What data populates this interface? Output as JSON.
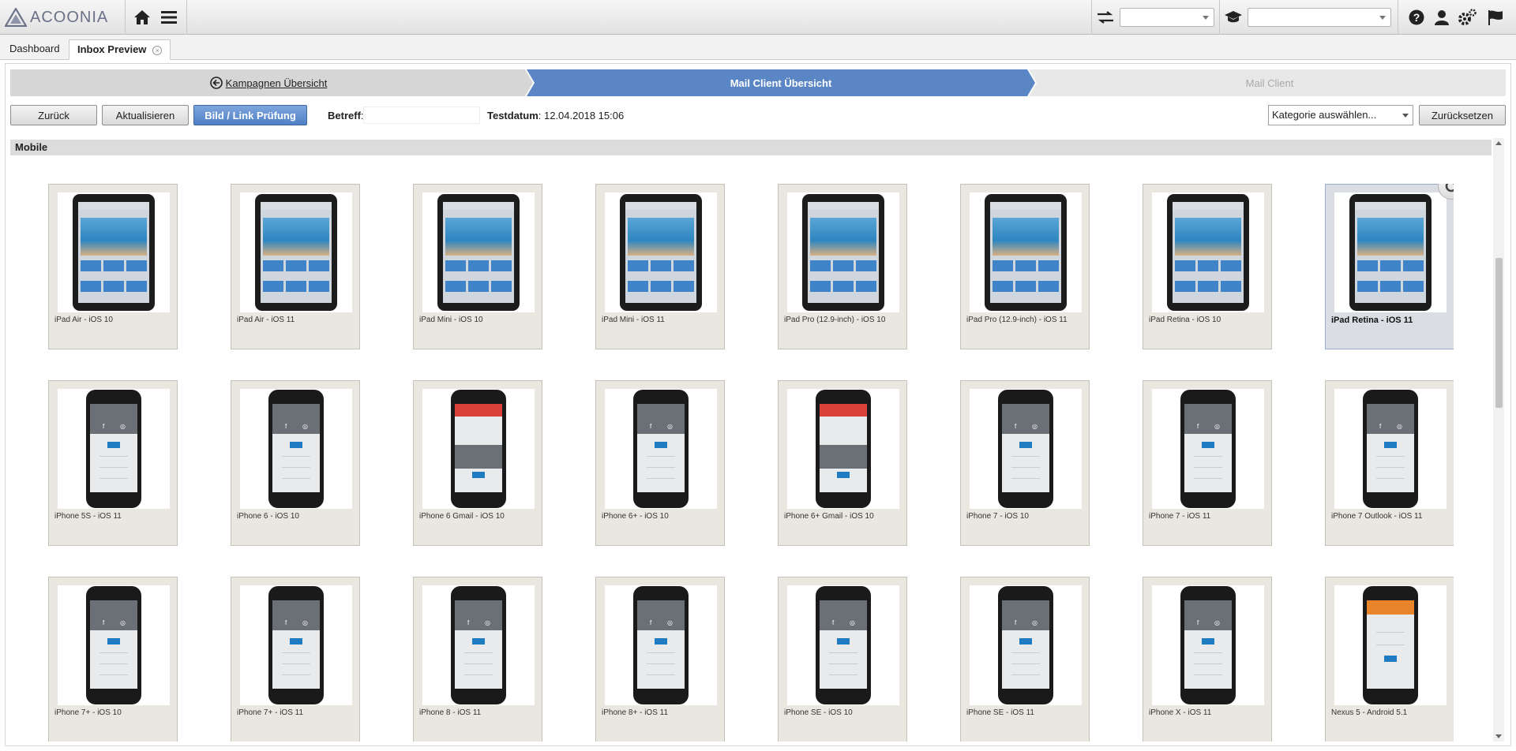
{
  "app": {
    "logo_text": "ACOONIA"
  },
  "tabs": [
    {
      "label": "Dashboard"
    },
    {
      "label": "Inbox Preview"
    }
  ],
  "wizard": {
    "step1": "Kampagnen Übersicht",
    "step2": "Mail Client Übersicht",
    "step3": "Mail Client"
  },
  "toolbar": {
    "back": "Zurück",
    "refresh": "Aktualisieren",
    "check": "Bild / Link Prüfung",
    "betreff_label": "Betreff",
    "betreff_colon": ":",
    "betreff_value": "",
    "testdatum_label": "Testdatum",
    "testdatum_value": ": 12.04.2018 15:06",
    "category_placeholder": "Kategorie auswählen...",
    "reset": "Zurücksetzen"
  },
  "section": {
    "title": "Mobile"
  },
  "colors": {
    "accent": "#5b86c5",
    "card_bg": "#e9e7e0"
  },
  "icons": [
    "home-icon",
    "menu-icon",
    "swap-icon",
    "graduation-cap-icon",
    "help-icon",
    "user-icon",
    "settings-icon",
    "flag-icon",
    "refresh-icon",
    "back-circle-icon"
  ],
  "clients": [
    {
      "label": "iPad Air - iOS 10",
      "device": "tablet"
    },
    {
      "label": "iPad Air - iOS 11",
      "device": "tablet"
    },
    {
      "label": "iPad Mini - iOS 10",
      "device": "tablet"
    },
    {
      "label": "iPad Mini - iOS 11",
      "device": "tablet"
    },
    {
      "label": "iPad Pro (12.9-inch) - iOS 10",
      "device": "tablet"
    },
    {
      "label": "iPad Pro (12.9-inch) - iOS 11",
      "device": "tablet"
    },
    {
      "label": "iPad Retina - iOS 10",
      "device": "tablet"
    },
    {
      "label": "iPad Retina - iOS 11",
      "device": "tablet",
      "selected": true
    },
    {
      "label": "iPhone 5S - iOS 11",
      "device": "phone"
    },
    {
      "label": "iPhone 6 - iOS 10",
      "device": "phone"
    },
    {
      "label": "iPhone 6 Gmail - iOS 10",
      "device": "phone-gmail"
    },
    {
      "label": "iPhone 6+ - iOS 10",
      "device": "phone"
    },
    {
      "label": "iPhone 6+ Gmail - iOS 10",
      "device": "phone-gmail"
    },
    {
      "label": "iPhone 7 - iOS 10",
      "device": "phone"
    },
    {
      "label": "iPhone 7 - iOS 11",
      "device": "phone"
    },
    {
      "label": "iPhone 7 Outlook - iOS 11",
      "device": "phone"
    },
    {
      "label": "iPhone 7+ - iOS 10",
      "device": "phone"
    },
    {
      "label": "iPhone 7+ - iOS 11",
      "device": "phone"
    },
    {
      "label": "iPhone 8 - iOS 11",
      "device": "phone"
    },
    {
      "label": "iPhone 8+ - iOS 11",
      "device": "phone"
    },
    {
      "label": "iPhone SE - iOS 10",
      "device": "phone"
    },
    {
      "label": "iPhone SE - iOS 11",
      "device": "phone"
    },
    {
      "label": "iPhone X - iOS 11",
      "device": "phone"
    },
    {
      "label": "Nexus 5 - Android 5.1",
      "device": "phone-android"
    }
  ]
}
